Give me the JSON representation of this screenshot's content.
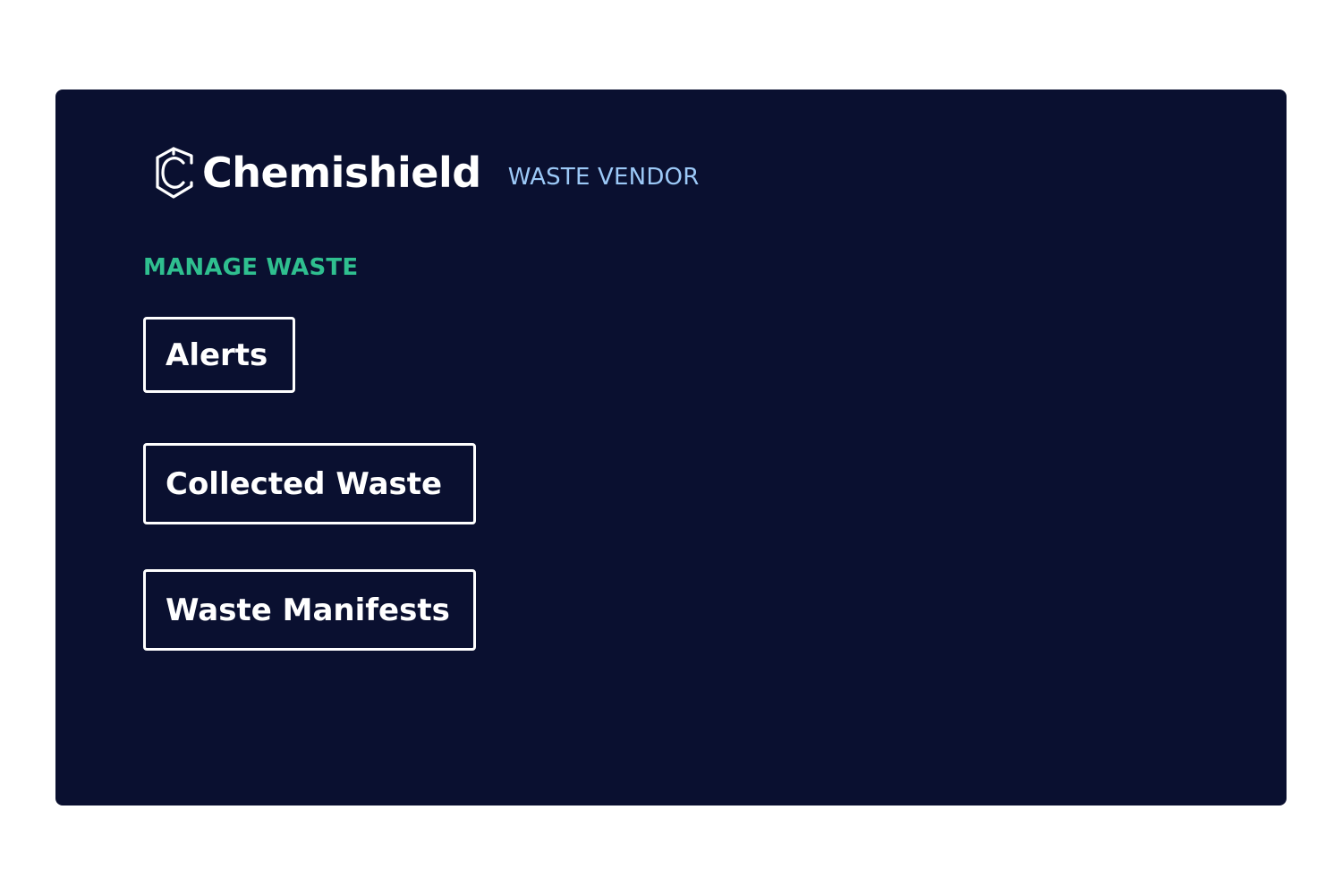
{
  "brand": {
    "name": "Chemishield",
    "logo_icon": "shield-c-icon",
    "role_badge": "WASTE VENDOR"
  },
  "section": {
    "heading": "MANAGE WASTE"
  },
  "nav": {
    "alerts_label": "Alerts",
    "collected_waste_label": "Collected Waste",
    "waste_manifests_label": "Waste Manifests"
  },
  "colors": {
    "panel_background": "#0a1030",
    "page_background": "#ffffff",
    "brand_text": "#ffffff",
    "role_badge": "#9cc9f7",
    "section_heading": "#2fbf8f",
    "button_border": "#ffffff",
    "button_text": "#ffffff"
  }
}
